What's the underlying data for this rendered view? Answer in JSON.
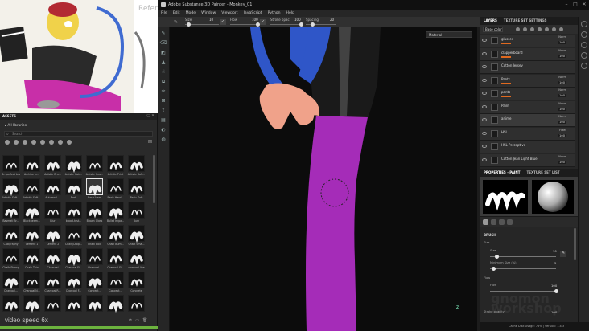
{
  "app": {
    "title": "Adobe Substance 3D Painter - Monkey_01",
    "menu": [
      "File",
      "Edit",
      "Mode",
      "Window",
      "Viewport",
      "JavaScript",
      "Python",
      "Help"
    ]
  },
  "reference": {
    "text": "Refere"
  },
  "toolbar": {
    "size_label": "Size",
    "size_value": "10",
    "flow_label": "Flow",
    "flow_value": "100",
    "stroke_opacity_label": "Stroke opac",
    "stroke_opacity_value": "100",
    "spacing_label": "Spacing",
    "spacing_value": "20",
    "size_fraction": 0.1,
    "flow_fraction": 1.0,
    "stroke_opacity_fraction": 1.0,
    "spacing_fraction": 0.2
  },
  "viewport": {
    "mode_select": "Material",
    "colors": {
      "jersey": "#2f56c8",
      "pants": "#a52cb8",
      "skin": "#f0a28a",
      "glossy": "#1a1a1a"
    }
  },
  "assets": {
    "title": "ASSETS",
    "library": "All libraries",
    "search_placeholder": "Search",
    "items": [
      "Dr. perfect brush",
      "Archive In...",
      "Artistic Bru...",
      "Artistic Hair...",
      "Artistic Hea...",
      "Artistic Print",
      "Artistic Soft...",
      "Artistic Soft...",
      "Artistic Soft...",
      "Autumn L...",
      "Bark",
      "Basic Hard",
      "Basic Hard...",
      "Basic Soft",
      "Basmati Br...",
      "Blackbeam...",
      "Blur",
      "broad-test...",
      "Brown Glass",
      "Bullet Impa...",
      "Burn",
      "Calligraphy",
      "Cement 1",
      "Cement 2",
      "Chain/Drop...",
      "Chalk Bold",
      "Chalk Bum...",
      "Chalk Sma...",
      "Chalk Strong",
      "Chalk Thin",
      "Charcoal",
      "Charcoal Fi...",
      "Charcoal...",
      "Charcoal Fi...",
      "charcoal line",
      "Charcoal...",
      "Charcoal N...",
      "Charcoal R...",
      "Charcoal F...",
      "Concept...",
      "Concept...",
      "Concrete",
      "",
      "",
      "",
      "",
      "",
      "",
      ""
    ],
    "selected_index": 11,
    "video_speed": "video speed 6x"
  },
  "layers": {
    "tabs": [
      "LAYERS",
      "TEXTURE SET SETTINGS"
    ],
    "blend_mode": "Base color",
    "rows": [
      {
        "name": "glasses",
        "blend": "Norm",
        "opacity": "100",
        "has_orange": true
      },
      {
        "name": "clapperboard",
        "blend": "Norm",
        "opacity": "100",
        "has_orange": true
      },
      {
        "name": "Cotton Jersey",
        "blend": "",
        "opacity": "",
        "has_orange": false
      },
      {
        "name": "Pants",
        "blend": "Norm",
        "opacity": "100",
        "has_orange": true
      },
      {
        "name": "pants",
        "blend": "Norm",
        "opacity": "100",
        "has_orange": true
      },
      {
        "name": "Paint",
        "blend": "Norm",
        "opacity": "100",
        "has_orange": false
      },
      {
        "name": "anime",
        "blend": "Norm",
        "opacity": "100",
        "has_orange": false
      },
      {
        "name": "HSL",
        "blend": "Filter",
        "opacity": "100",
        "has_orange": false
      },
      {
        "name": "HSL Perceptive",
        "blend": "",
        "opacity": "",
        "has_orange": false
      },
      {
        "name": "Cotton Jean Light Blue",
        "blend": "Norm",
        "opacity": "100",
        "has_orange": false
      }
    ]
  },
  "properties": {
    "tabs": [
      "PROPERTIES - PAINT",
      "TEXTURE SET LIST"
    ],
    "section_brush": "BRUSH",
    "size_label": "Size",
    "size_value": "10",
    "size_fraction": 0.1,
    "min_size_label": "Minimum Size (%)",
    "min_size_value": "5",
    "min_size_fraction": 0.05,
    "flow_section": "Flow",
    "flow_label": "Flow",
    "flow_value": "100",
    "flow_fraction": 1.0,
    "stroke_opacity_label": "Stroke opacity",
    "stroke_opacity_value": "100"
  },
  "status": {
    "text": "Cache Disk Usage: 76% | Version: 7.4.3"
  },
  "watermark": {
    "text": "gnomon workshop"
  }
}
